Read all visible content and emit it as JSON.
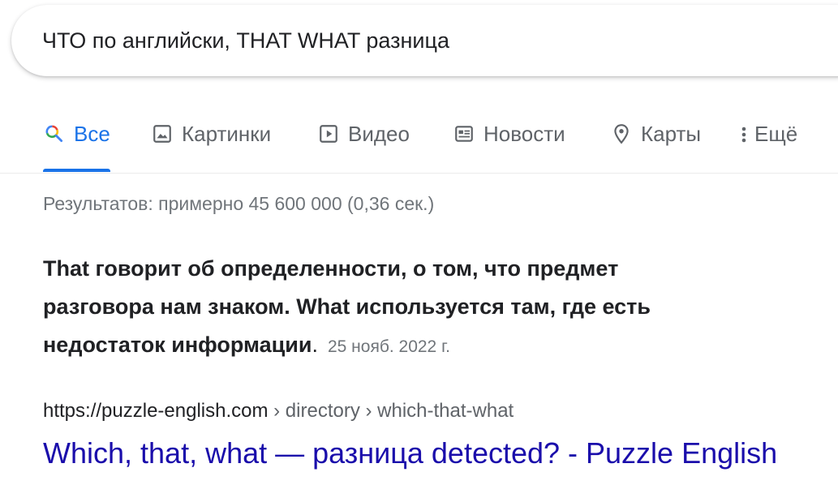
{
  "search": {
    "query": "ЧТО по английски, THAT WHAT разница"
  },
  "tabs": [
    {
      "label": "Все",
      "icon": "google-search-icon",
      "active": true
    },
    {
      "label": "Картинки",
      "icon": "image-icon"
    },
    {
      "label": "Видео",
      "icon": "video-play-icon"
    },
    {
      "label": "Новости",
      "icon": "news-icon"
    },
    {
      "label": "Карты",
      "icon": "map-pin-icon"
    },
    {
      "label": "Ещё",
      "icon": "more-vert-icon"
    }
  ],
  "stats": "Результатов: примерно 45 600 000 (0,36 сек.)",
  "snippet": {
    "text": "That говорит об определенности, о том, что предмет разговора нам знаком. What используется там, где есть недостаток информации",
    "trailing": ".",
    "date": "25 нояб. 2022 г."
  },
  "result": {
    "domain": "https://puzzle-english.com",
    "breadcrumbs": " › directory › which-that-what",
    "title": "Which, that, what — разница detected? - Puzzle English"
  },
  "colors": {
    "accent": "#1a73e8",
    "link": "#1a0dab",
    "muted": "#70757a"
  }
}
